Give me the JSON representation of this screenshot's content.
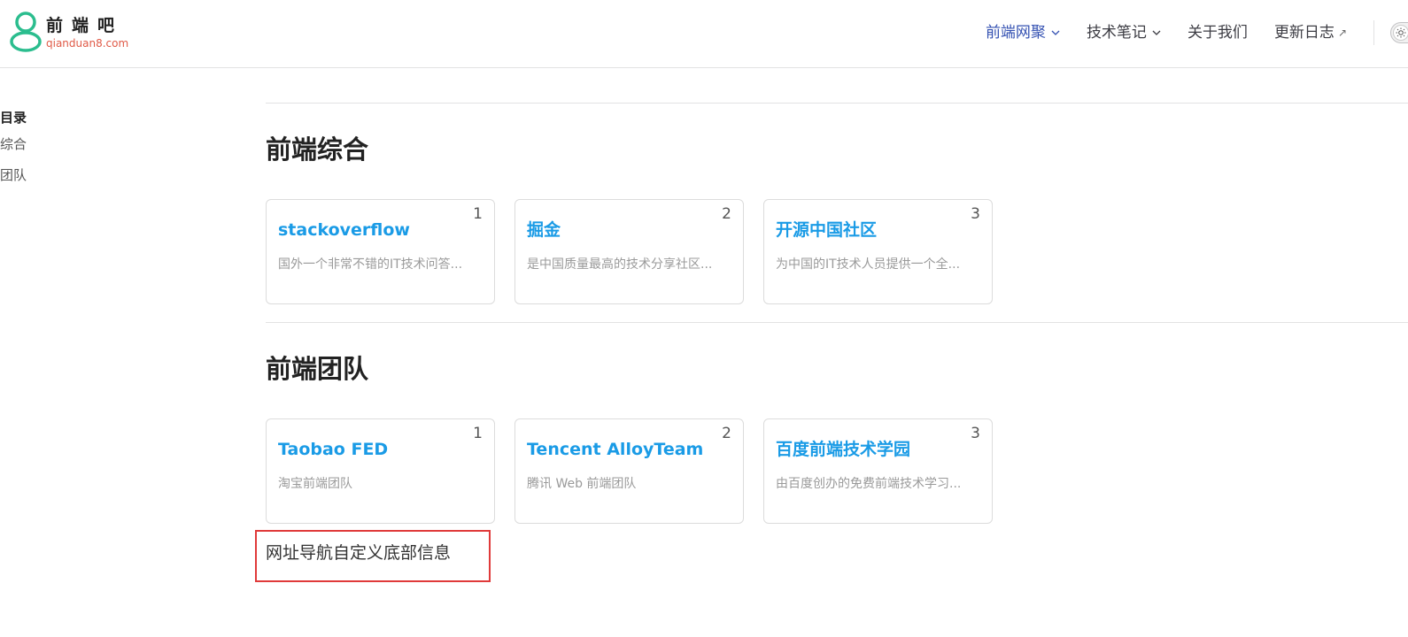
{
  "brand": {
    "title": "前端吧",
    "domain": "qianduan8.com"
  },
  "nav": {
    "items": [
      {
        "label": "前端网聚",
        "dropdown": true,
        "active": true
      },
      {
        "label": "技术笔记",
        "dropdown": true,
        "active": false
      },
      {
        "label": "关于我们",
        "dropdown": false,
        "active": false
      },
      {
        "label": "更新日志",
        "external": true,
        "active": false
      }
    ],
    "external_icon": "↗"
  },
  "sidebar": {
    "title": "页目录",
    "links": [
      "端综合",
      "端团队"
    ]
  },
  "sections": [
    {
      "title": "前端综合",
      "cards": [
        {
          "index": "1",
          "name": "stackoverflow",
          "desc": "国外一个非常不错的IT技术问答..."
        },
        {
          "index": "2",
          "name": "掘金",
          "desc": "是中国质量最高的技术分享社区..."
        },
        {
          "index": "3",
          "name": "开源中国社区",
          "desc": "为中国的IT技术人员提供一个全..."
        }
      ]
    },
    {
      "title": "前端团队",
      "cards": [
        {
          "index": "1",
          "name": "Taobao FED",
          "desc": "淘宝前端团队"
        },
        {
          "index": "2",
          "name": "Tencent AlloyTeam",
          "desc": "腾讯 Web 前端团队"
        },
        {
          "index": "3",
          "name": "百度前端技术学园",
          "desc": "由百度创办的免费前端技术学习..."
        }
      ]
    }
  ],
  "footer": {
    "text": "网址导航自定义底部信息"
  },
  "colors": {
    "accent": "#3451b2",
    "link": "#1a9be6",
    "highlight_box": "#e03a3a",
    "logo_green": "#2bbd8e"
  },
  "icons": {
    "chevron": "chevron-down-icon",
    "theme": "sun-icon"
  }
}
